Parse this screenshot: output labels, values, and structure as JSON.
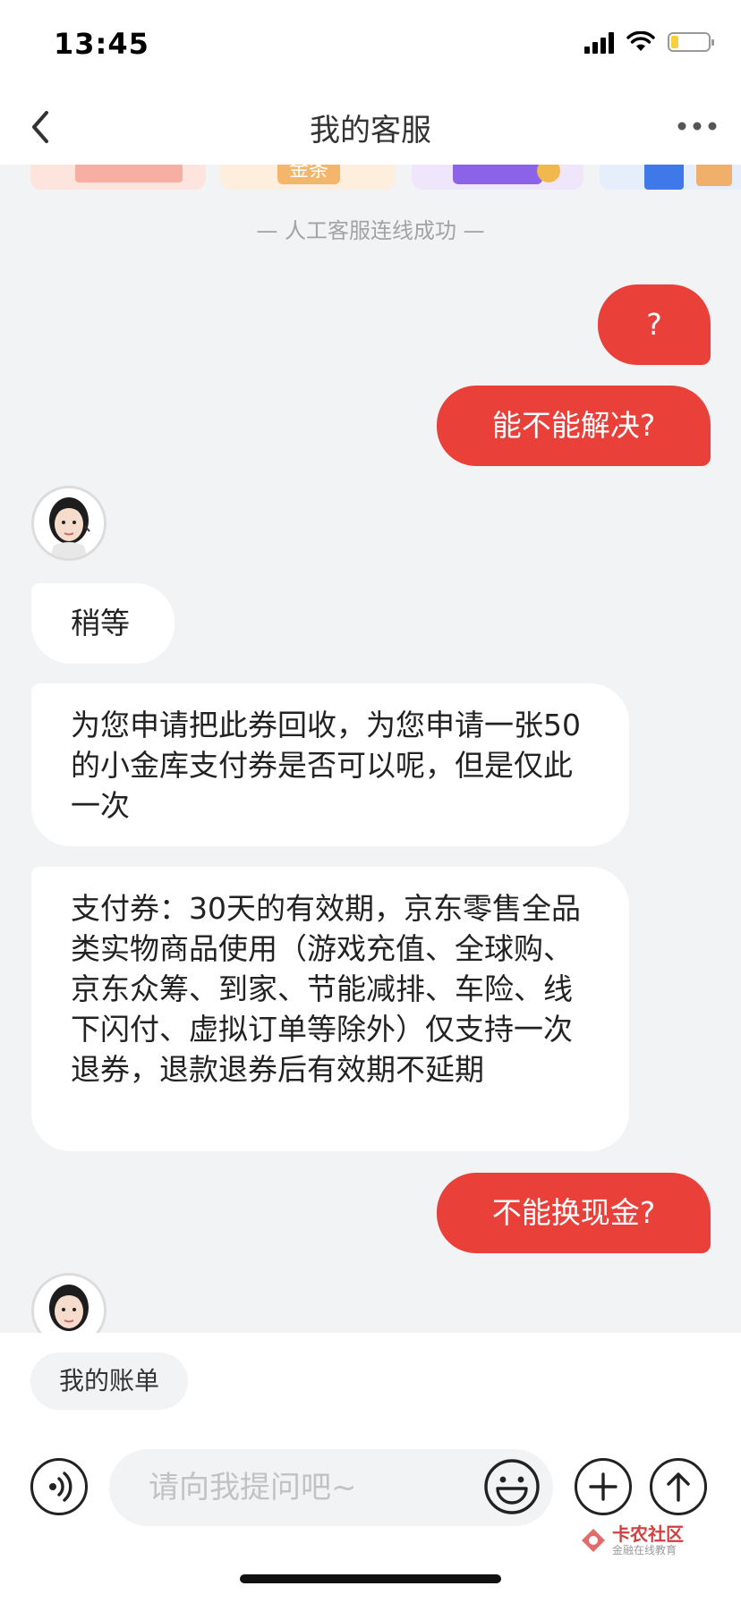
{
  "status_bar": {
    "time": "13:45"
  },
  "header": {
    "title": "我的客服"
  },
  "banners": [
    {
      "text": ""
    },
    {
      "text": "金条"
    },
    {
      "text": ""
    },
    {
      "text": ""
    }
  ],
  "system_message": "— 人工客服连线成功 —",
  "messages": [
    {
      "side": "out",
      "text": "?"
    },
    {
      "side": "out",
      "text": "能不能解决?"
    },
    {
      "side": "in",
      "text": "稍等"
    },
    {
      "side": "in",
      "text": "为您申请把此券回收，为您申请一张50的小金库支付券是否可以呢，但是仅此一次"
    },
    {
      "side": "in",
      "text": "支付券：30天的有效期，京东零售全品类实物商品使用（游戏充值、全球购、京东众筹、到家、节能减排、车险、线下闪付、虚拟订单等除外）仅支持一次退券，退款退券后有效期不延期"
    },
    {
      "side": "out",
      "text": "不能换现金?"
    }
  ],
  "quick_reply": {
    "label": "我的账单"
  },
  "input": {
    "placeholder": "请向我提问吧~"
  },
  "watermark": {
    "title": "卡农社区",
    "subtitle": "金融在线教育"
  },
  "colors": {
    "accent": "#e9403a",
    "background": "#f2f3f5"
  }
}
